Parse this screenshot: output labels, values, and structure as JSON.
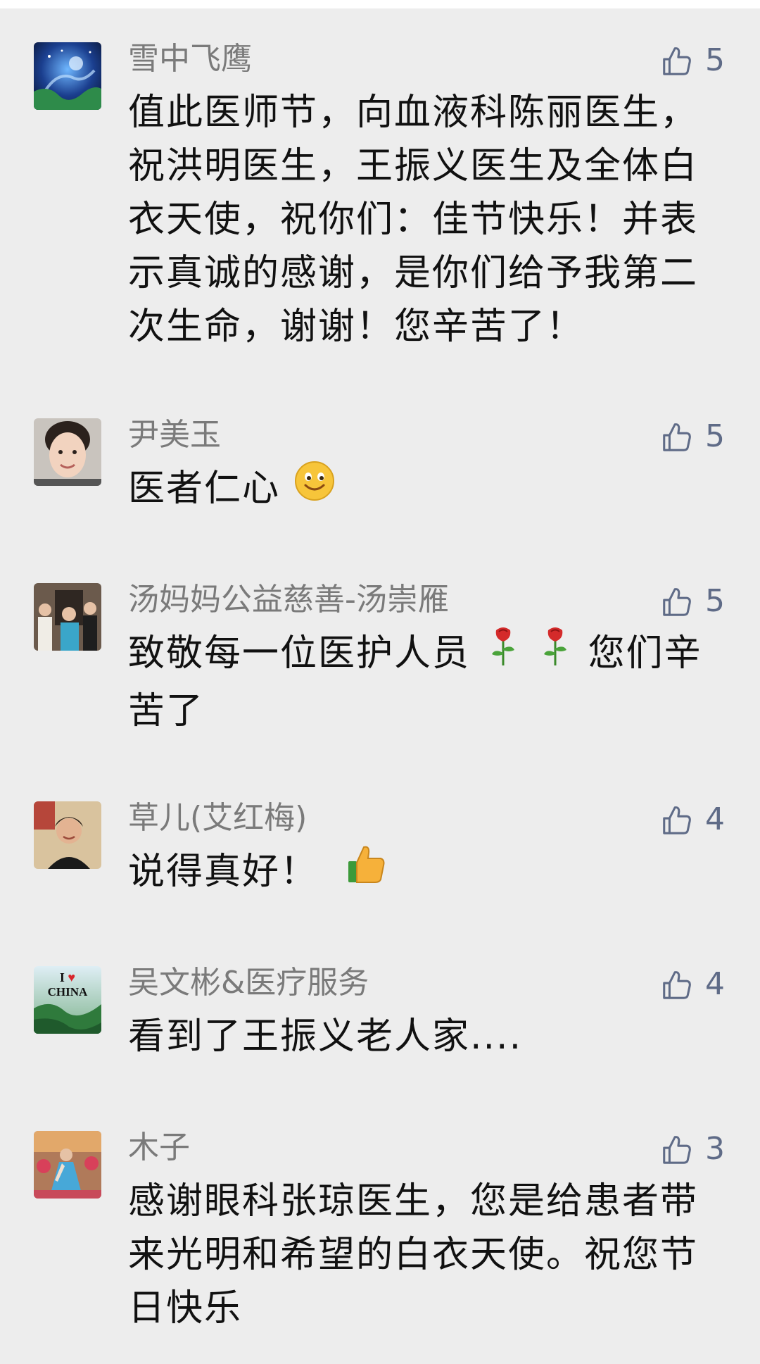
{
  "comments": [
    {
      "author": "雪中飞鹰",
      "likes": "5",
      "text": "值此医师节，向血液科陈丽医生，祝洪明医生，王振义医生及全体白衣天使，祝你们：佳节快乐！并表示真诚的感谢，是你们给予我第二次生命，谢谢！您辛苦了！",
      "avatar_icon": "night-sky-fantasy-avatar"
    },
    {
      "author": "尹美玉",
      "likes": "5",
      "text": "医者仁心",
      "emoji": "smiling-face-emoji",
      "avatar_icon": "woman-portrait-avatar"
    },
    {
      "author": "汤妈妈公益慈善-汤崇雁",
      "likes": "5",
      "text_before": "致敬每一位医护人员",
      "emoji": "rose-emoji",
      "text_after": "您们辛苦了",
      "avatar_icon": "group-photo-avatar"
    },
    {
      "author": "草儿(艾红梅)",
      "likes": "4",
      "text": "说得真好！",
      "emoji": "thumbs-up-emoji",
      "avatar_icon": "woman-smiling-avatar"
    },
    {
      "author": "吴文彬&医疗服务",
      "likes": "4",
      "text": "看到了王振义老人家....",
      "avatar_icon": "i-love-china-avatar",
      "avatar_text": "I ♥ CHINA"
    },
    {
      "author": "木子",
      "likes": "3",
      "text": "感谢眼科张琼医生，您是给患者带来光明和希望的白衣天使。祝您节日快乐",
      "avatar_icon": "dancer-photo-avatar"
    }
  ],
  "like_icon": "thumbs-up-outline-icon",
  "colors": {
    "background": "#ededed",
    "author": "#7a7a7a",
    "text": "#111111",
    "like": "#5f6b87"
  }
}
